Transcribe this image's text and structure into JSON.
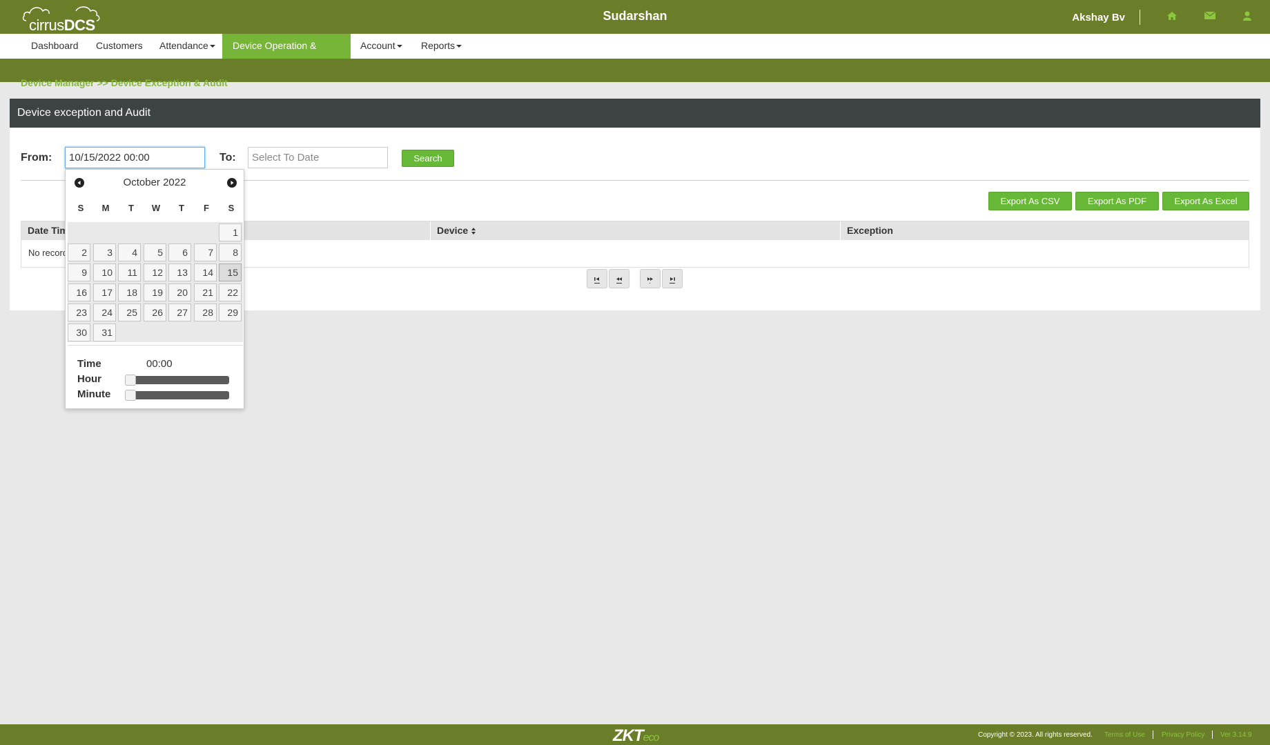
{
  "app": {
    "logo_text_light": "cirrus",
    "logo_text_bold": "DCS",
    "org_name": "Sudarshan",
    "user_name": "Akshay Bv"
  },
  "top_icons": [
    "home-icon",
    "envelope-icon",
    "user-icon"
  ],
  "menu": [
    {
      "label": "Dashboard",
      "dropdown": false,
      "active": false
    },
    {
      "label": "Customers",
      "dropdown": false,
      "active": false
    },
    {
      "label": "Attendance",
      "dropdown": true,
      "active": false
    },
    {
      "label": "Device Operation & Audit",
      "dropdown": true,
      "active": true
    },
    {
      "label": "Account",
      "dropdown": true,
      "active": false
    },
    {
      "label": "Reports",
      "dropdown": true,
      "active": false
    }
  ],
  "breadcrumb": "Device Manager >> Device Exception & Audit",
  "panel": {
    "title": "Device exception and Audit"
  },
  "filter": {
    "from_label": "From:",
    "from_value": "10/15/2022 00:00",
    "to_label": "To:",
    "to_placeholder": "Select To Date",
    "search_label": "Search"
  },
  "export": {
    "csv": "Export As CSV",
    "pdf": "Export As PDF",
    "excel": "Export As Excel"
  },
  "table": {
    "columns": [
      "Date Time",
      "Device",
      "Exception"
    ],
    "empty_text": "No records"
  },
  "datepicker": {
    "month_title": "October 2022",
    "weekdays": [
      "S",
      "M",
      "T",
      "W",
      "T",
      "F",
      "S"
    ],
    "days": [
      1,
      2,
      3,
      4,
      5,
      6,
      7,
      8,
      9,
      10,
      11,
      12,
      13,
      14,
      15,
      16,
      17,
      18,
      19,
      20,
      21,
      22,
      23,
      24,
      25,
      26,
      27,
      28,
      29,
      30,
      31
    ],
    "selected_day": 15,
    "time_label": "Time",
    "time_value": "00:00",
    "hour_label": "Hour",
    "minute_label": "Minute",
    "hour_value": 0,
    "minute_value": 0
  },
  "footer": {
    "logo_main": "ZKT",
    "logo_sub": "eco",
    "copyright": "Copyright © 2023. All rights reserved.",
    "terms": "Terms of Use",
    "privacy": "Privacy Policy",
    "version": "Ver 3.14.9"
  },
  "colors": {
    "brand_olive": "#6a7d28",
    "accent_green": "#77b539",
    "button_green": "#68b838",
    "panel_header": "#3d4244"
  }
}
